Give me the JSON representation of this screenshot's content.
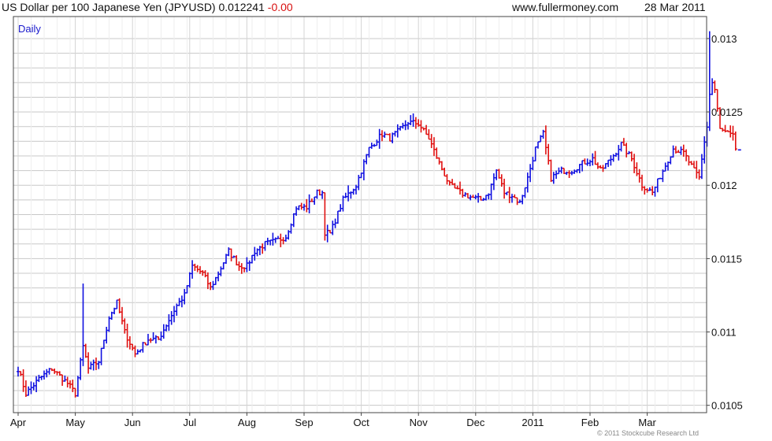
{
  "header": {
    "title": "US Dollar per 100 Japanese Yen (JPYUSD)",
    "last": "0.012241",
    "change": "-0.00",
    "site": "www.fullermoney.com",
    "date": "28 Mar 2011"
  },
  "copyright": "© 2011 Stockcube Research Ltd",
  "colors": {
    "up": "#1010e0",
    "down": "#e01010",
    "grid": "#d8d8d8",
    "frame": "#444444"
  },
  "chart_data": {
    "type": "bar",
    "period_label": "Daily",
    "ylim": [
      0.01045,
      0.01315
    ],
    "y_ticks": [
      {
        "v": 0.0105,
        "label": "0.0105"
      },
      {
        "v": 0.011,
        "label": "0.011"
      },
      {
        "v": 0.0115,
        "label": "0.0115"
      },
      {
        "v": 0.012,
        "label": "0.012"
      },
      {
        "v": 0.0125,
        "label": "0.0125"
      },
      {
        "v": 0.013,
        "label": "0.013"
      }
    ],
    "x_ticks": [
      {
        "i": 0,
        "label": "Apr"
      },
      {
        "i": 22,
        "label": "May"
      },
      {
        "i": 44,
        "label": "Jun"
      },
      {
        "i": 66,
        "label": "Jul"
      },
      {
        "i": 88,
        "label": "Aug"
      },
      {
        "i": 110,
        "label": "Sep"
      },
      {
        "i": 132,
        "label": "Oct"
      },
      {
        "i": 154,
        "label": "Nov"
      },
      {
        "i": 176,
        "label": "Dec"
      },
      {
        "i": 198,
        "label": "2011"
      },
      {
        "i": 220,
        "label": "Feb"
      },
      {
        "i": 242,
        "label": "Mar"
      }
    ],
    "anchors": [
      [
        0,
        0.01075
      ],
      [
        3,
        0.01058
      ],
      [
        8,
        0.01068
      ],
      [
        13,
        0.01075
      ],
      [
        19,
        0.01065
      ],
      [
        22,
        0.01058
      ],
      [
        25,
        0.0109
      ],
      [
        27,
        0.01075
      ],
      [
        31,
        0.0108
      ],
      [
        35,
        0.0111
      ],
      [
        38,
        0.0112
      ],
      [
        41,
        0.011
      ],
      [
        45,
        0.01085
      ],
      [
        50,
        0.01095
      ],
      [
        54,
        0.01095
      ],
      [
        57,
        0.01105
      ],
      [
        61,
        0.01118
      ],
      [
        64,
        0.01125
      ],
      [
        67,
        0.01145
      ],
      [
        71,
        0.0114
      ],
      [
        74,
        0.0113
      ],
      [
        77,
        0.0114
      ],
      [
        81,
        0.01155
      ],
      [
        85,
        0.01145
      ],
      [
        88,
        0.01145
      ],
      [
        91,
        0.01155
      ],
      [
        95,
        0.0116
      ],
      [
        99,
        0.01162
      ],
      [
        103,
        0.01165
      ],
      [
        107,
        0.01185
      ],
      [
        111,
        0.01185
      ],
      [
        115,
        0.01195
      ],
      [
        117,
        0.01195
      ],
      [
        118,
        0.01168
      ],
      [
        120,
        0.01167
      ],
      [
        125,
        0.0119
      ],
      [
        130,
        0.012
      ],
      [
        135,
        0.01225
      ],
      [
        140,
        0.01235
      ],
      [
        143,
        0.01232
      ],
      [
        147,
        0.01238
      ],
      [
        150,
        0.01243
      ],
      [
        154,
        0.01242
      ],
      [
        158,
        0.01232
      ],
      [
        162,
        0.01215
      ],
      [
        166,
        0.012
      ],
      [
        170,
        0.01195
      ],
      [
        174,
        0.01192
      ],
      [
        178,
        0.0119
      ],
      [
        181,
        0.01195
      ],
      [
        184,
        0.0121
      ],
      [
        187,
        0.01195
      ],
      [
        190,
        0.01193
      ],
      [
        193,
        0.01188
      ],
      [
        196,
        0.01205
      ],
      [
        199,
        0.01225
      ],
      [
        202,
        0.01235
      ],
      [
        205,
        0.01205
      ],
      [
        209,
        0.0121
      ],
      [
        213,
        0.0121
      ],
      [
        217,
        0.01215
      ],
      [
        221,
        0.01218
      ],
      [
        224,
        0.0121
      ],
      [
        228,
        0.01218
      ],
      [
        232,
        0.01228
      ],
      [
        236,
        0.01218
      ],
      [
        240,
        0.012
      ],
      [
        244,
        0.01195
      ],
      [
        248,
        0.0121
      ],
      [
        252,
        0.01225
      ],
      [
        256,
        0.01222
      ],
      [
        260,
        0.0121
      ],
      [
        262,
        0.01205
      ],
      [
        264,
        0.0123
      ],
      [
        265,
        0.0124
      ],
      [
        266,
        0.01262
      ],
      [
        267,
        0.0127
      ],
      [
        268,
        0.01265
      ],
      [
        270,
        0.01238
      ],
      [
        273,
        0.01235
      ],
      [
        275,
        0.01233
      ],
      [
        276,
        0.01225
      ]
    ]
  }
}
